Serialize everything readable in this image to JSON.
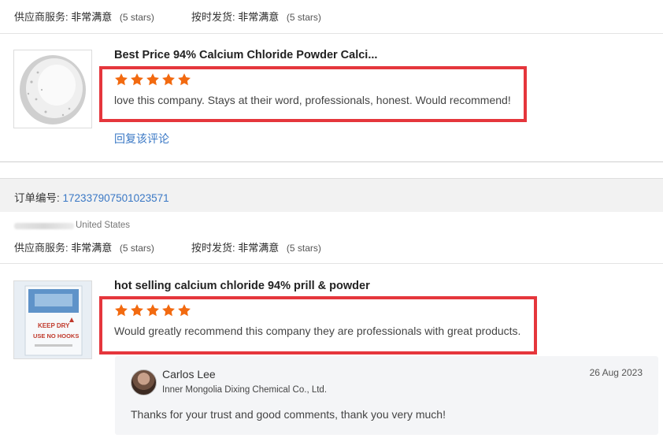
{
  "review1": {
    "supplier_service_label": "供应商服务:",
    "supplier_service_value": "非常满意",
    "supplier_service_stars": "(5 stars)",
    "shipping_label": "按时发货:",
    "shipping_value": "非常满意",
    "shipping_stars": "(5 stars)",
    "product_title": "Best Price 94% Calcium Chloride Powder Calci...",
    "rating": 5,
    "text": "love this company. Stays at their word, professionals, honest. Would recommend!",
    "reply_link": "回复该评论"
  },
  "order": {
    "label": "订单编号:",
    "number": "172337907501023571"
  },
  "review2": {
    "country": "United States",
    "supplier_service_label": "供应商服务:",
    "supplier_service_value": "非常满意",
    "supplier_service_stars": "(5 stars)",
    "shipping_label": "按时发货:",
    "shipping_value": "非常满意",
    "shipping_stars": "(5 stars)",
    "product_title": "hot selling calcium chloride 94% prill & powder",
    "rating": 5,
    "text": "Would greatly recommend this company they are professionals with great products.",
    "bag_text": [
      "KEEP DRY",
      "USE NO HOOKS"
    ],
    "reply": {
      "name": "Carlos Lee",
      "company": "Inner Mongolia Dixing Chemical Co., Ltd.",
      "date": "26 Aug 2023",
      "text": "Thanks for your trust and good comments, thank you very much!"
    }
  },
  "colors": {
    "star": "#f26a10",
    "highlight_box": "#e5363c",
    "link": "#3a78c5"
  }
}
